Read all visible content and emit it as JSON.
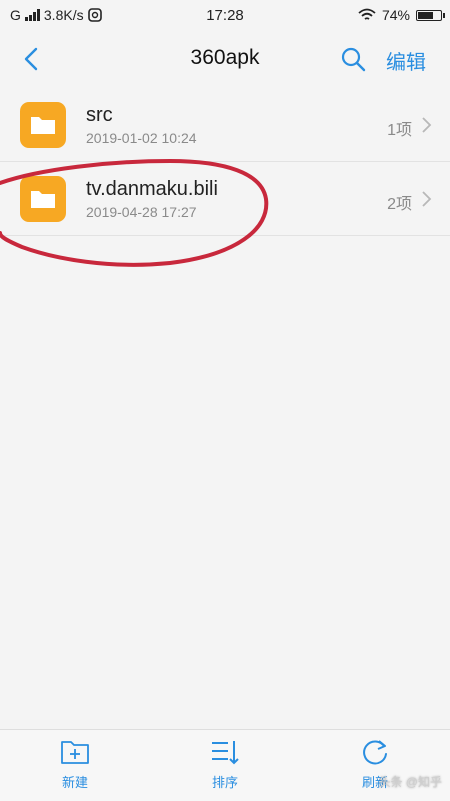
{
  "status_bar": {
    "left_text": "G",
    "speed": "3.8K/s",
    "time": "17:28",
    "battery": "74%",
    "battery_level": 0.74
  },
  "header": {
    "title": "360apk",
    "edit_label": "编辑",
    "icons": [
      "back-icon",
      "search-icon"
    ]
  },
  "files": [
    {
      "name": "src",
      "date": "2019-01-02 10:24",
      "count": "1项",
      "icon": "folder-icon"
    },
    {
      "name": "tv.danmaku.bili",
      "date": "2019-04-28 17:27",
      "count": "2项",
      "icon": "folder-icon"
    }
  ],
  "toolbar": {
    "new_label": "新建",
    "sort_label": "排序",
    "refresh_label": "刷新"
  },
  "colors": {
    "accent": "#2a8ee0",
    "folder": "#f7a823",
    "annotation": "#c8283c"
  },
  "watermark": "头条 @知乎"
}
